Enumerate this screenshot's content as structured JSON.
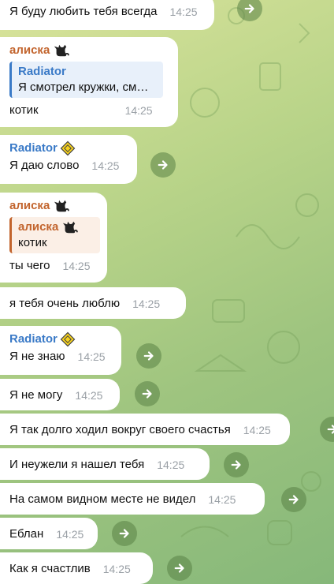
{
  "messages": [
    {
      "text": "Я буду любить тебя всегда",
      "time": "14:25"
    },
    {
      "author": "алиска",
      "quote_author": "Radiator",
      "quote_text": "Я смотрел кружки, см…",
      "text": "котик",
      "time": "14:25"
    },
    {
      "author": "Radiator",
      "text": "Я даю слово",
      "time": "14:25"
    },
    {
      "author": "алиска",
      "quote_author": "алиска",
      "quote_text": "котик",
      "text": "ты чего",
      "time": "14:25"
    },
    {
      "text": "я тебя очень люблю",
      "time": "14:25"
    },
    {
      "author": "Radiator",
      "text": "Я не знаю",
      "time": "14:25"
    },
    {
      "text": "Я не могу",
      "time": "14:25"
    },
    {
      "text": "Я так долго ходил вокруг своего счастья",
      "time": "14:25"
    },
    {
      "text": "И неужели я нашел тебя",
      "time": "14:25"
    },
    {
      "text": "На самом видном месте не видел",
      "time": "14:25"
    },
    {
      "text": "Еблан",
      "time": "14:25"
    },
    {
      "text": "Как я счастлив",
      "time": "14:25"
    }
  ],
  "icons": {
    "forward": "forward-arrow-icon",
    "cat": "black-cat-emoji",
    "badge": "yellow-diamond-sign-emoji"
  },
  "colors": {
    "author_alisa": "#c2642d",
    "author_radiator": "#3a7ac7",
    "time": "#9aa0a6",
    "bubble": "#ffffff"
  }
}
